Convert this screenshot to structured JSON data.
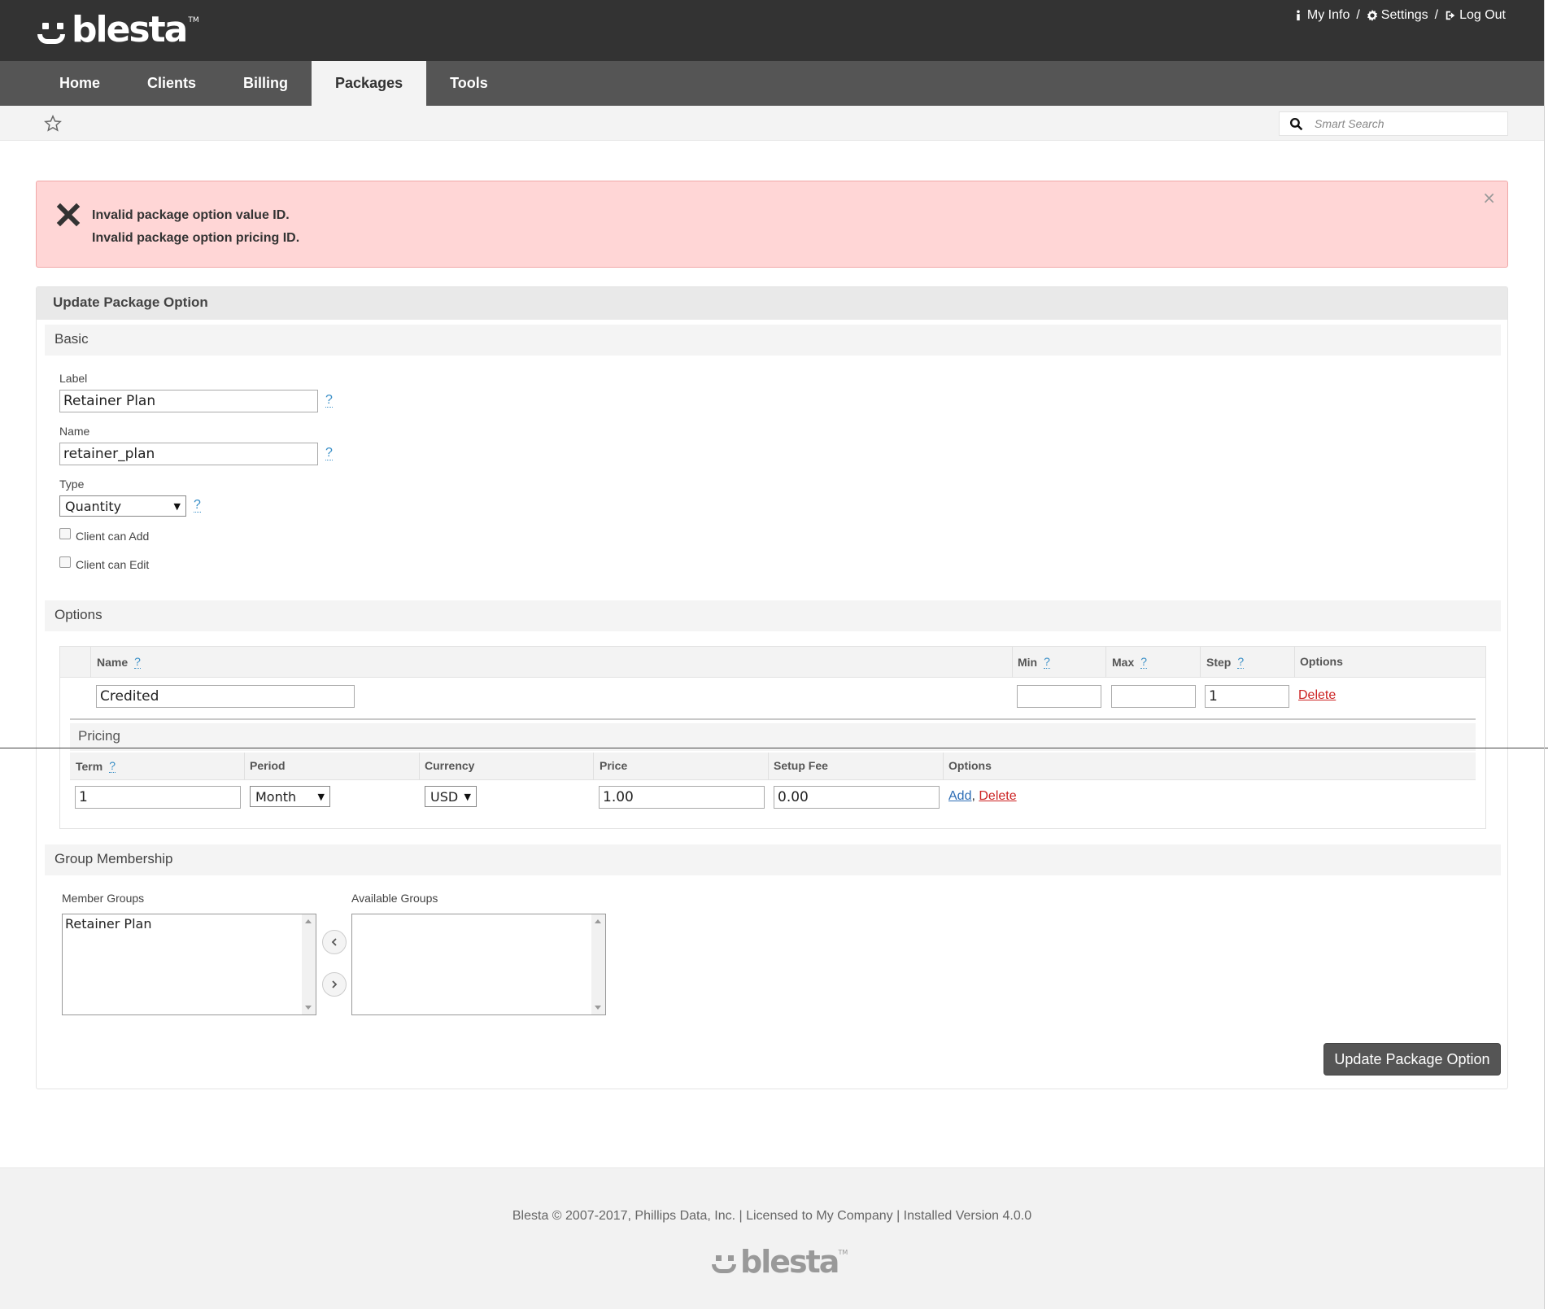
{
  "brand": {
    "name": "blesta",
    "tm": "TM"
  },
  "top_links": {
    "my_info": "My Info",
    "settings": "Settings",
    "log_out": "Log Out",
    "sep": "/"
  },
  "nav": {
    "tabs": [
      "Home",
      "Clients",
      "Billing",
      "Packages",
      "Tools"
    ],
    "active": "Packages"
  },
  "search": {
    "placeholder": "Smart Search"
  },
  "alert": {
    "messages": [
      "Invalid package option value ID.",
      "Invalid package option pricing ID."
    ],
    "close": "×"
  },
  "panel": {
    "title": "Update Package Option",
    "basic": {
      "heading": "Basic",
      "label_label": "Label",
      "label_value": "Retainer Plan",
      "name_label": "Name",
      "name_value": "retainer_plan",
      "type_label": "Type",
      "type_value": "Quantity",
      "client_can_add": "Client can Add",
      "client_can_edit": "Client can Edit",
      "help": "?"
    },
    "options": {
      "heading": "Options",
      "columns": {
        "name": "Name",
        "min": "Min",
        "max": "Max",
        "step": "Step",
        "options": "Options"
      },
      "row": {
        "name": "Credited",
        "min": "",
        "max": "",
        "step": "1",
        "delete": "Delete"
      },
      "pricing": {
        "heading": "Pricing",
        "columns": {
          "term": "Term",
          "period": "Period",
          "currency": "Currency",
          "price": "Price",
          "setup_fee": "Setup Fee",
          "options": "Options"
        },
        "row": {
          "term": "1",
          "period": "Month",
          "currency": "USD",
          "price": "1.00",
          "setup_fee": "0.00",
          "add": "Add",
          "comma": ",",
          "delete": "Delete"
        }
      }
    },
    "groups": {
      "heading": "Group Membership",
      "member_label": "Member Groups",
      "available_label": "Available Groups",
      "member_items": [
        "Retainer Plan"
      ],
      "available_items": []
    },
    "submit": "Update Package Option"
  },
  "footer": {
    "text": "Blesta © 2007-2017, Phillips Data, Inc. | Licensed to My Company | Installed Version 4.0.0"
  },
  "colors": {
    "header": "#333333",
    "nav": "#555555",
    "alert_bg": "#ffd6d6",
    "help": "#3a8fc7",
    "danger_link": "#cc2222",
    "add_link": "#2d6db5"
  }
}
